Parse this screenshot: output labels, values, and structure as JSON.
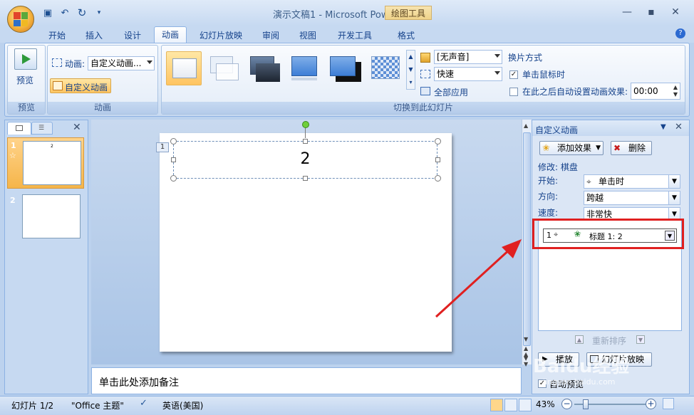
{
  "window": {
    "title": "演示文稿1 - Microsoft PowerPoint",
    "context_tool": "绘图工具"
  },
  "tabs": [
    "开始",
    "插入",
    "设计",
    "动画",
    "幻灯片放映",
    "审阅",
    "视图",
    "开发工具",
    "格式"
  ],
  "active_tab": "动画",
  "ribbon": {
    "preview": {
      "button": "预览",
      "group": "预览"
    },
    "animation": {
      "label": "动画:",
      "value": "自定义动画...",
      "custom_button": "自定义动画",
      "group": "动画"
    },
    "transition": {
      "sound": "[无声音]",
      "speed": "快速",
      "apply_all": "全部应用",
      "advance_title": "换片方式",
      "on_click": "单击鼠标时",
      "auto_after": "在此之后自动设置动画效果:",
      "auto_time": "00:00",
      "group": "切换到此幻灯片"
    }
  },
  "slides_pane": {
    "slides": [
      {
        "number": "1",
        "star": "☆",
        "text": "2"
      },
      {
        "number": "2",
        "star": "",
        "text": ""
      }
    ]
  },
  "slide": {
    "anim_tag": "1",
    "title_text": "2"
  },
  "notes": {
    "placeholder": "单击此处添加备注"
  },
  "task_pane": {
    "title": "自定义动画",
    "add_effect": "添加效果",
    "remove": "删除",
    "modify": "修改: 棋盘",
    "start_label": "开始:",
    "start_value": "单击时",
    "direction_label": "方向:",
    "direction_value": "跨越",
    "speed_label": "速度:",
    "speed_value": "非常快",
    "item": {
      "index": "1",
      "text": "标题 1: 2"
    },
    "reorder": "重新排序",
    "play": "播放",
    "slideshow": "幻灯片放映",
    "autopreview": "自动预览"
  },
  "status": {
    "slide": "幻灯片 1/2",
    "theme": "\"Office 主题\"",
    "language": "英语(美国)",
    "zoom": "43%"
  },
  "watermark": {
    "text": "Baidu经验",
    "url": "jingyan.baidu.com"
  },
  "colors": {
    "highlight_red": "#e02020",
    "accent_orange": "#f5b54a"
  }
}
